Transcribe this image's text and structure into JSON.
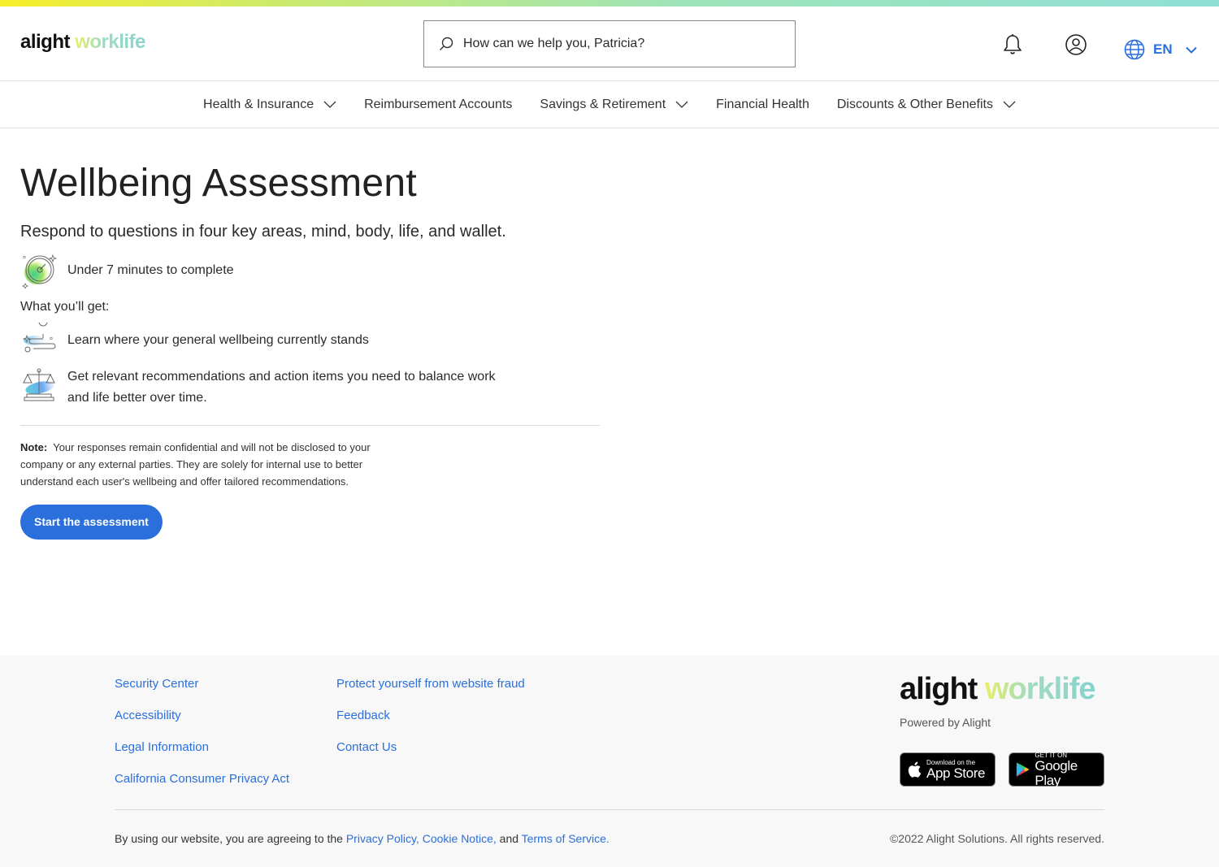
{
  "header": {
    "logo_primary": "alight",
    "logo_secondary": "worklife",
    "search_placeholder": "How can we help you, Patricia?",
    "icons": [
      "search-icon",
      "bell-icon",
      "user-icon",
      "globe-icon",
      "chevron-down-icon"
    ],
    "language": "EN",
    "accent_color": "#2a6fdb"
  },
  "nav": {
    "items": [
      {
        "label": "Health & Insurance",
        "has_dropdown": true
      },
      {
        "label": "Reimbursement Accounts",
        "has_dropdown": false
      },
      {
        "label": "Savings & Retirement",
        "has_dropdown": true
      },
      {
        "label": "Financial Health",
        "has_dropdown": false
      },
      {
        "label": "Discounts & Other Benefits",
        "has_dropdown": true
      }
    ]
  },
  "main": {
    "title": "Wellbeing Assessment",
    "subtitle": "Respond to questions in four key areas, mind, body, life, and wallet.",
    "duration": "Under 7 minutes to complete",
    "what_heading": "What you’ll get:",
    "benefits": [
      "Learn where your general wellbeing currently stands",
      "Get relevant recommendations and action items you need to balance work and life better over time."
    ],
    "note_label": "Note:",
    "note_text": "Your responses remain confidential and will not be disclosed to your company or any external parties. They are solely for internal use to better understand each user's wellbeing and offer tailored recommendations.",
    "start_button": "Start the assessment"
  },
  "footer": {
    "col1": [
      "Security Center",
      "Accessibility",
      "Legal Information",
      "California Consumer Privacy Act"
    ],
    "col2": [
      "Protect yourself from website fraud",
      "Feedback",
      "Contact Us"
    ],
    "logo_primary": "alight",
    "logo_secondary": "worklife",
    "powered_by": "Powered by Alight",
    "app_store_small": "Download on the",
    "app_store_big": "App Store",
    "google_play_small": "GET IT ON",
    "google_play_big": "Google Play",
    "legal_prefix": "By using our website, you are agreeing to the",
    "privacy_policy": "Privacy Policy,",
    "cookie_notice": "Cookie Notice,",
    "legal_and": "and",
    "terms": "Terms of Service.",
    "copyright": "©2022 Alight Solutions. All rights reserved."
  }
}
